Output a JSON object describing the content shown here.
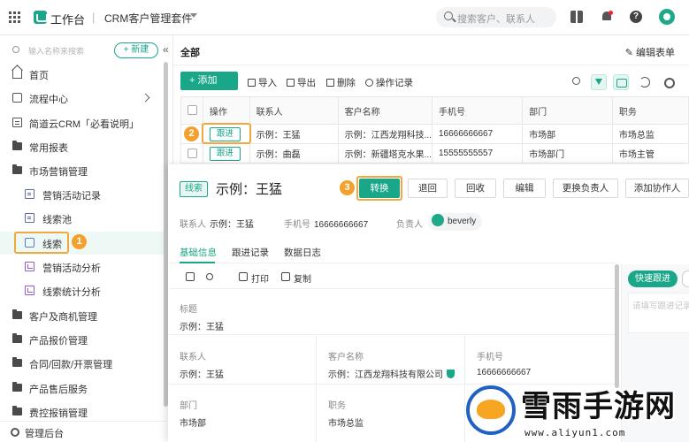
{
  "topbar": {
    "workbench": "工作台",
    "separator": "|",
    "suite": "CRM客户管理套件",
    "search_placeholder": "搜索客户、联系人",
    "help": "?"
  },
  "sidebar": {
    "search_placeholder": "输入名称来搜索",
    "new_label": "+ 新建",
    "collapse": "«",
    "items": [
      {
        "label": "首页"
      },
      {
        "label": "流程中心"
      },
      {
        "label": "简道云CRM「必看说明」"
      },
      {
        "label": "常用报表"
      },
      {
        "label": "市场营销管理"
      },
      {
        "label": "营销活动记录"
      },
      {
        "label": "线索池"
      },
      {
        "label": "线索"
      },
      {
        "label": "营销活动分析"
      },
      {
        "label": "线索统计分析"
      },
      {
        "label": "客户及商机管理"
      },
      {
        "label": "产品报价管理"
      },
      {
        "label": "合同/回款/开票管理"
      },
      {
        "label": "产品售后服务"
      },
      {
        "label": "费控报销管理"
      }
    ],
    "bottom": "管理后台"
  },
  "badges": [
    "1",
    "2",
    "3"
  ],
  "main": {
    "title": "全部",
    "edit_form": "✎ 编辑表单",
    "toolbar": {
      "add": "+ 添加",
      "import": "导入",
      "export": "导出",
      "delete": "删除",
      "log": "操作记录"
    },
    "table": {
      "headers": [
        "操作",
        "联系人",
        "客户名称",
        "手机号",
        "部门",
        "职务"
      ],
      "rows": [
        {
          "action": "跟进",
          "contact": "示例：王猛",
          "customer": "示例：江西龙翔科技...",
          "phone": "16666666667",
          "dept": "市场部",
          "title": "市场总监"
        },
        {
          "action": "跟进",
          "contact": "示例：曲磊",
          "customer": "示例：新疆塔克水果...",
          "phone": "15555555557",
          "dept": "市场部门",
          "title": "市场主管"
        }
      ]
    }
  },
  "drawer": {
    "tag": "线索",
    "title": "示例：王猛",
    "actions": {
      "convert": "转换",
      "back": "退回",
      "recycle": "回收",
      "edit": "编辑",
      "change_owner": "更换负责人",
      "add_collab": "添加协作人"
    },
    "meta": {
      "contact_k": "联系人",
      "contact_v": "示例：王猛",
      "phone_k": "手机号",
      "phone_v": "16666666667",
      "owner_k": "负责人",
      "owner_v": "beverly"
    },
    "tabs": [
      "基础信息",
      "跟进记录",
      "数据日志"
    ],
    "subbar": {
      "print": "打印",
      "copy": "复制"
    },
    "fields": {
      "title_k": "标题",
      "title_v": "示例：王猛",
      "contact_k": "联系人",
      "contact_v": "示例：王猛",
      "customer_k": "客户名称",
      "customer_v": "示例：江西龙翔科技有限公司",
      "phone_k": "手机号",
      "phone_v": "16666666667",
      "dept_k": "部门",
      "dept_v": "市场部",
      "job_k": "职务",
      "job_v": "市场总监"
    },
    "quick": {
      "button": "快速跟进",
      "placeholder": "请填写跟进记录"
    }
  },
  "watermark": {
    "text": "雪雨手游网",
    "url": "www.aliyun1.com"
  }
}
